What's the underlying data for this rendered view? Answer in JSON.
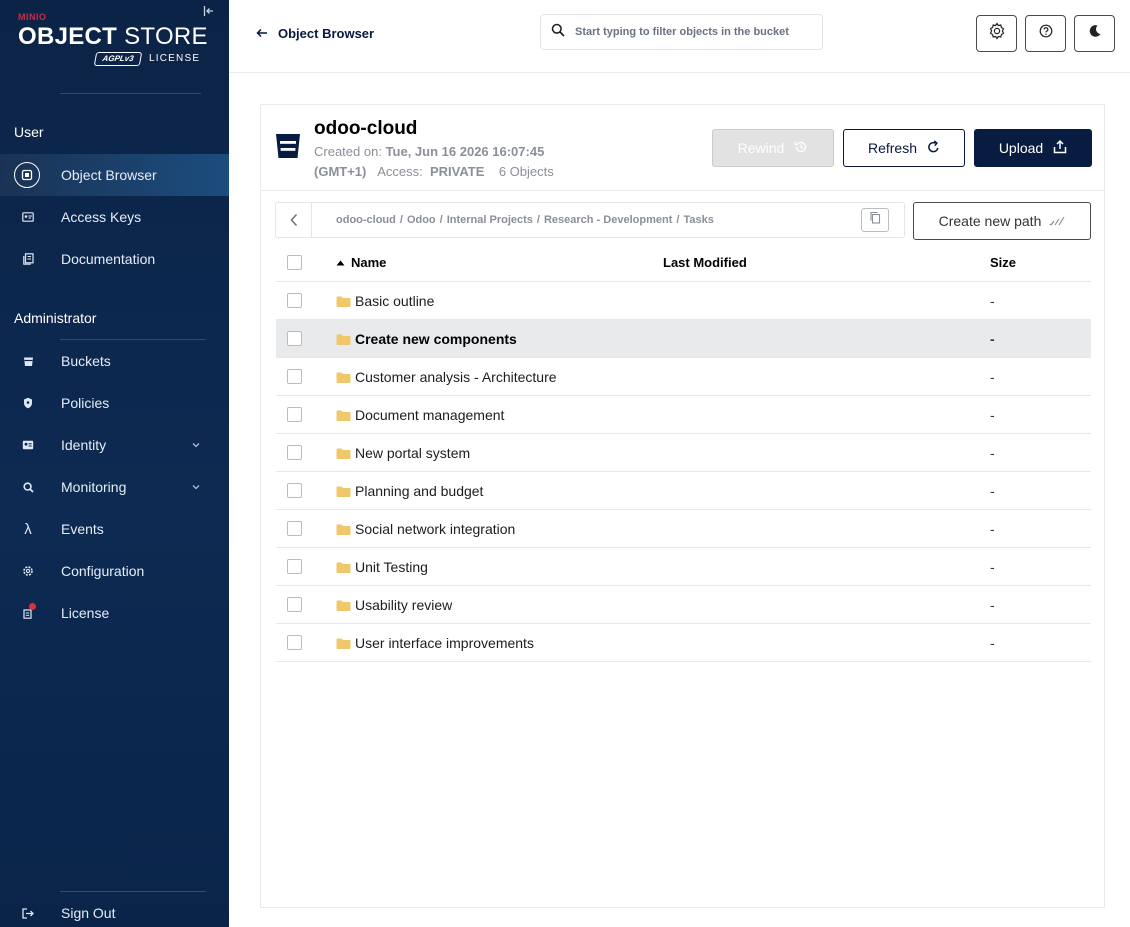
{
  "logo": {
    "brand": "MINIO",
    "product_bold": "OBJECT",
    "product_rest": " STORE",
    "badge": "AGPLv3",
    "license": "LICENSE"
  },
  "sidebar": {
    "user_section": "User",
    "user_items": [
      {
        "label": "Object Browser",
        "icon": "object-browser-icon"
      },
      {
        "label": "Access Keys",
        "icon": "access-keys-icon"
      },
      {
        "label": "Documentation",
        "icon": "documentation-icon"
      }
    ],
    "admin_section": "Administrator",
    "admin_items": [
      {
        "label": "Buckets",
        "icon": "buckets-icon"
      },
      {
        "label": "Policies",
        "icon": "policies-icon"
      },
      {
        "label": "Identity",
        "icon": "identity-icon"
      },
      {
        "label": "Monitoring",
        "icon": "monitoring-icon"
      },
      {
        "label": "Events",
        "icon": "events-icon"
      },
      {
        "label": "Configuration",
        "icon": "configuration-icon"
      },
      {
        "label": "License",
        "icon": "license-icon"
      }
    ],
    "sign_out": "Sign Out"
  },
  "header": {
    "back_label": "Object Browser",
    "search_placeholder": "Start typing to filter objects in the bucket"
  },
  "bucket": {
    "name": "odoo-cloud",
    "created_label": "Created on:",
    "created_value": "Tue, Jun 16 2026 16:07:45",
    "timezone": "(GMT+1)",
    "access_label": "Access:",
    "access_value": "PRIVATE",
    "objects": "6 Objects"
  },
  "actions": {
    "rewind": "Rewind",
    "refresh": "Refresh",
    "upload": "Upload",
    "create_path": "Create new path"
  },
  "breadcrumb": [
    "odoo-cloud",
    "Odoo",
    "Internal Projects",
    "Research - Development",
    "Tasks"
  ],
  "table": {
    "columns": {
      "name": "Name",
      "modified": "Last Modified",
      "size": "Size"
    },
    "rows": [
      {
        "name": "Basic outline",
        "modified": "",
        "size": "-"
      },
      {
        "name": "Create new components",
        "modified": "",
        "size": "-"
      },
      {
        "name": "Customer analysis - Architecture",
        "modified": "",
        "size": "-"
      },
      {
        "name": "Document management",
        "modified": "",
        "size": "-"
      },
      {
        "name": "New portal system",
        "modified": "",
        "size": "-"
      },
      {
        "name": "Planning and budget",
        "modified": "",
        "size": "-"
      },
      {
        "name": "Social network integration",
        "modified": "",
        "size": "-"
      },
      {
        "name": "Unit Testing",
        "modified": "",
        "size": "-"
      },
      {
        "name": "Usability review",
        "modified": "",
        "size": "-"
      },
      {
        "name": "User interface improvements",
        "modified": "",
        "size": "-"
      }
    ],
    "highlighted_row": 1
  },
  "colors": {
    "sidebar_bg": "#0b2346",
    "primary": "#081c42",
    "license_dot": "#e0303f",
    "folder": "#f1c76b"
  }
}
